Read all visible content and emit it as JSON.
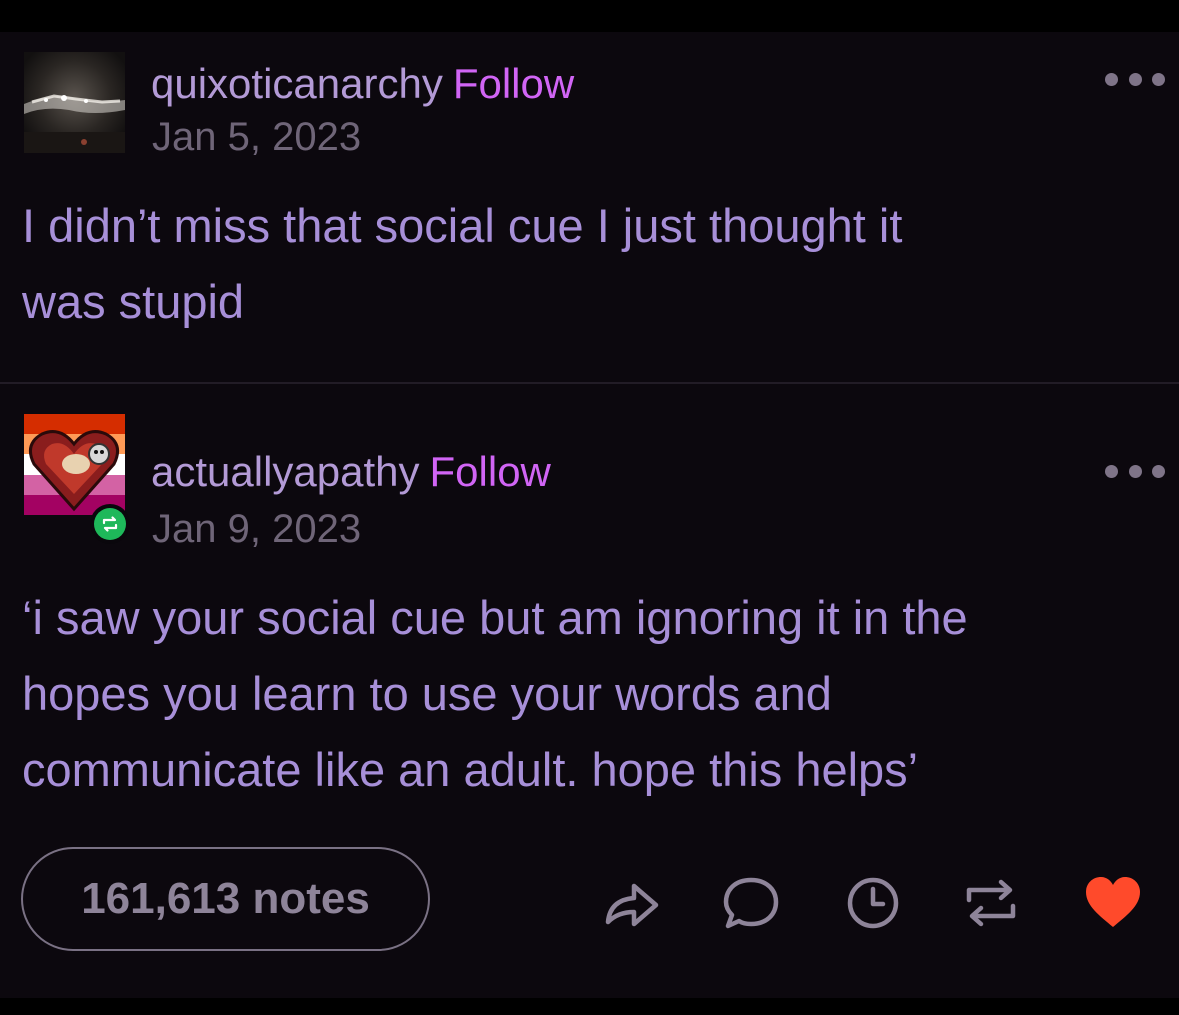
{
  "posts": [
    {
      "username": "quixoticanarchy",
      "follow_label": "Follow",
      "date": "Jan 5, 2023",
      "body": "I didn’t miss that social cue I just thought it\nwas stupid"
    },
    {
      "username": "actuallyapathy",
      "follow_label": "Follow",
      "date": "Jan 9, 2023",
      "body": "‘i saw your social cue but am ignoring it in the\nhopes you learn to use your words and\ncommunicate like an adult.  hope this helps’"
    }
  ],
  "footer": {
    "notes_label": "161,613 notes",
    "actions": [
      "share-icon",
      "reply-icon",
      "clock-icon",
      "reblog-icon",
      "heart-icon"
    ]
  },
  "colors": {
    "background": "#0c080e",
    "username": "#b39ad6",
    "follow": "#d165f5",
    "body_text": "#a78fd8",
    "date": "#6f6578",
    "liked_heart": "#ff4a2b",
    "reblog_badge": "#1eb85a"
  }
}
